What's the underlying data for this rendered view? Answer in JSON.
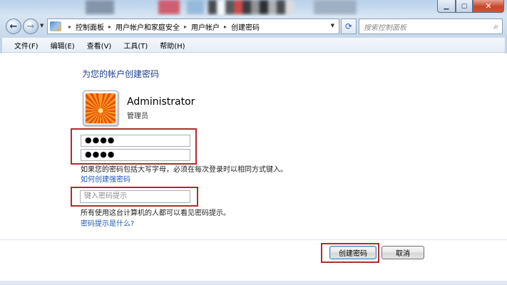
{
  "window": {
    "min_icon": "minimize-icon",
    "max_icon": "maximize-icon",
    "close_icon": "close-icon"
  },
  "nav": {
    "back_icon": "back-arrow-icon",
    "forward_icon": "forward-arrow-icon",
    "breadcrumbs": [
      "控制面板",
      "用户帐户和家庭安全",
      "用户帐户",
      "创建密码"
    ],
    "search_placeholder": "搜索控制面板"
  },
  "menu": {
    "items": [
      "文件(F)",
      "编辑(E)",
      "查看(V)",
      "工具(T)",
      "帮助(H)"
    ]
  },
  "page": {
    "heading": "为您的帐户创建密码",
    "user": {
      "name": "Administrator",
      "type": "管理员",
      "avatar_icon": "flower-avatar-icon"
    },
    "new_password_value": "●●●●",
    "confirm_password_value": "●●●●",
    "case_note": "如果您的密码包括大写字母，必须在每次登录时以相同方式键入。",
    "strong_password_link": "如何创建强密码",
    "hint_placeholder": "键入密码提示",
    "hint_note": "所有使用这台计算机的人都可以看见密码提示。",
    "hint_link": "密码提示是什么?",
    "create_button": "创建密码",
    "cancel_button": "取消"
  },
  "colors": {
    "heading": "#1e3d8f",
    "link": "#1f58b3",
    "highlight_box": "#b22b2b"
  }
}
